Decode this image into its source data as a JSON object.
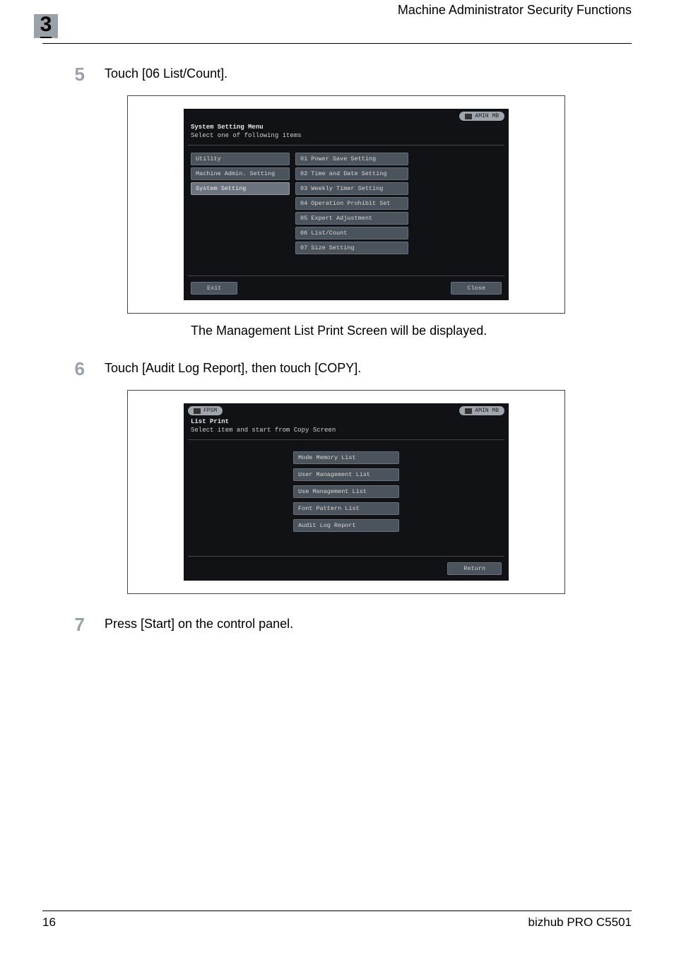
{
  "header": {
    "chapter_number": "3",
    "title": "Machine Administrator Security Functions"
  },
  "steps": [
    {
      "num": "5",
      "text": "Touch [06 List/Count]."
    },
    {
      "num": "6",
      "text": "Touch [Audit Log Report], then touch [COPY]."
    },
    {
      "num": "7",
      "text": "Press [Start] on the control panel."
    }
  ],
  "screen1": {
    "badge_right": "AMIN MB",
    "title": "System Setting Menu",
    "subtitle": "Select one of following items",
    "left_items": [
      "Utility",
      "Machine Admin. Setting",
      "System Setting"
    ],
    "right_items": [
      "01 Power Save Setting",
      "02 Time and Date Setting",
      "03 Weekly Timer Setting",
      "04 Operation Prohibit Set",
      "05 Expert Adjustment",
      "06 List/Count",
      "07 Size Setting"
    ],
    "footer_left": "Exit",
    "footer_right": "Close"
  },
  "after_screen1": "The Management List Print Screen will be displayed.",
  "screen2": {
    "badge_left": "FPSM",
    "badge_right": "AMIN MB",
    "title": "List Print",
    "subtitle": "Select item and start from Copy Screen",
    "center_items": [
      "Mode Memory List",
      "User Management List",
      "Use Management List",
      "Font Pattern List",
      "Audit Log Report"
    ],
    "footer_right": "Return"
  },
  "footer": {
    "page": "16",
    "product": "bizhub PRO C5501"
  }
}
